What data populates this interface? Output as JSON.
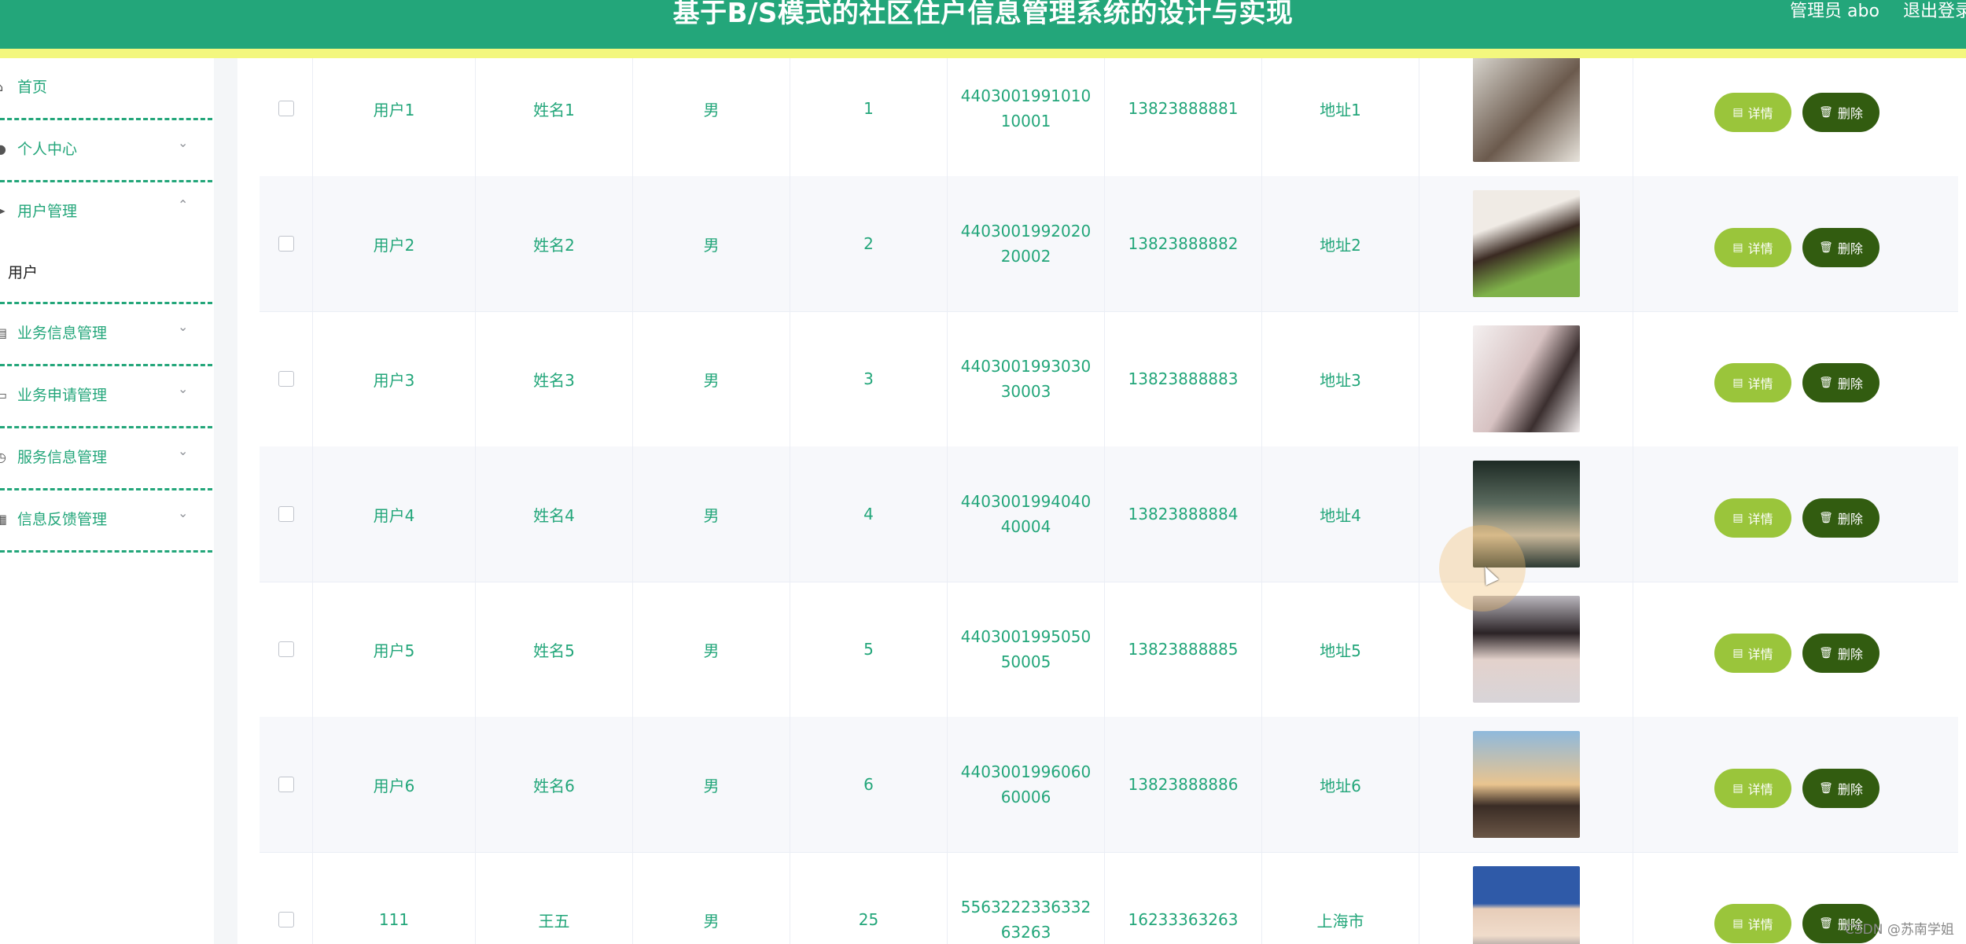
{
  "header": {
    "title": "基于B/S模式的社区住户信息管理系统的设计与实现",
    "admin": "管理员 abo",
    "logout": "退出登录"
  },
  "sidebar": {
    "items": [
      {
        "label": "首页",
        "icon": "home-icon"
      },
      {
        "label": "个人中心",
        "icon": "user-icon"
      },
      {
        "label": "用户管理",
        "icon": "pin-icon"
      },
      {
        "label": "业务信息管理",
        "icon": "briefcase-icon"
      },
      {
        "label": "业务申请管理",
        "icon": "monitor-icon"
      },
      {
        "label": "服务信息管理",
        "icon": "clock-icon"
      },
      {
        "label": "信息反馈管理",
        "icon": "document-icon"
      }
    ],
    "sub": {
      "label": "用户"
    }
  },
  "table": {
    "rows": [
      {
        "account": "用户1",
        "name": "姓名1",
        "gender": "男",
        "age": "1",
        "idcard": "440300199101010001",
        "phone": "13823888881",
        "address": "地址1"
      },
      {
        "account": "用户2",
        "name": "姓名2",
        "gender": "男",
        "age": "2",
        "idcard": "440300199202020002",
        "phone": "13823888882",
        "address": "地址2"
      },
      {
        "account": "用户3",
        "name": "姓名3",
        "gender": "男",
        "age": "3",
        "idcard": "440300199303030003",
        "phone": "13823888883",
        "address": "地址3"
      },
      {
        "account": "用户4",
        "name": "姓名4",
        "gender": "男",
        "age": "4",
        "idcard": "440300199404040004",
        "phone": "13823888884",
        "address": "地址4"
      },
      {
        "account": "用户5",
        "name": "姓名5",
        "gender": "男",
        "age": "5",
        "idcard": "440300199505050005",
        "phone": "13823888885",
        "address": "地址5"
      },
      {
        "account": "用户6",
        "name": "姓名6",
        "gender": "男",
        "age": "6",
        "idcard": "440300199606060006",
        "phone": "13823888886",
        "address": "地址6"
      },
      {
        "account": "111",
        "name": "王五",
        "gender": "男",
        "age": "25",
        "idcard": "556322233633263263",
        "phone": "16233363263",
        "address": "上海市"
      }
    ],
    "detail_label": "详情",
    "delete_label": "删除"
  },
  "watermark": "CSDN @苏南学姐",
  "colors": {
    "header": "#23a67a",
    "stripe": "#f3f77e",
    "text_accent": "#23a67a",
    "detail_button": "#9ac53b",
    "delete_button": "#325c10"
  }
}
